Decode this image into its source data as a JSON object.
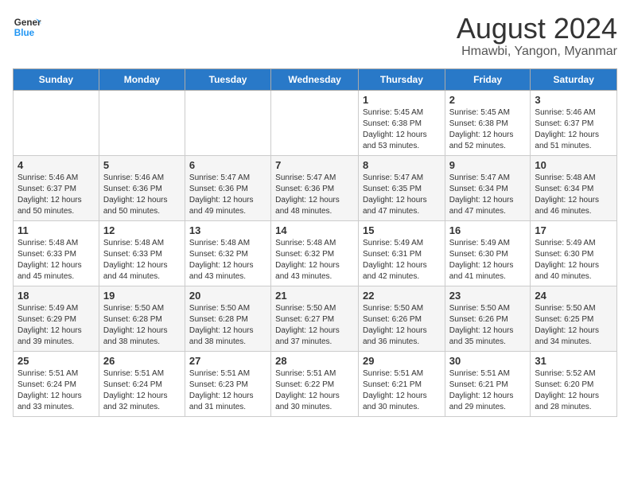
{
  "logo": {
    "line1": "General",
    "line2": "Blue"
  },
  "title": "August 2024",
  "subtitle": "Hmawbi, Yangon, Myanmar",
  "days_of_week": [
    "Sunday",
    "Monday",
    "Tuesday",
    "Wednesday",
    "Thursday",
    "Friday",
    "Saturday"
  ],
  "weeks": [
    [
      {
        "day": "",
        "info": ""
      },
      {
        "day": "",
        "info": ""
      },
      {
        "day": "",
        "info": ""
      },
      {
        "day": "",
        "info": ""
      },
      {
        "day": "1",
        "info": "Sunrise: 5:45 AM\nSunset: 6:38 PM\nDaylight: 12 hours\nand 53 minutes."
      },
      {
        "day": "2",
        "info": "Sunrise: 5:45 AM\nSunset: 6:38 PM\nDaylight: 12 hours\nand 52 minutes."
      },
      {
        "day": "3",
        "info": "Sunrise: 5:46 AM\nSunset: 6:37 PM\nDaylight: 12 hours\nand 51 minutes."
      }
    ],
    [
      {
        "day": "4",
        "info": "Sunrise: 5:46 AM\nSunset: 6:37 PM\nDaylight: 12 hours\nand 50 minutes."
      },
      {
        "day": "5",
        "info": "Sunrise: 5:46 AM\nSunset: 6:36 PM\nDaylight: 12 hours\nand 50 minutes."
      },
      {
        "day": "6",
        "info": "Sunrise: 5:47 AM\nSunset: 6:36 PM\nDaylight: 12 hours\nand 49 minutes."
      },
      {
        "day": "7",
        "info": "Sunrise: 5:47 AM\nSunset: 6:36 PM\nDaylight: 12 hours\nand 48 minutes."
      },
      {
        "day": "8",
        "info": "Sunrise: 5:47 AM\nSunset: 6:35 PM\nDaylight: 12 hours\nand 47 minutes."
      },
      {
        "day": "9",
        "info": "Sunrise: 5:47 AM\nSunset: 6:34 PM\nDaylight: 12 hours\nand 47 minutes."
      },
      {
        "day": "10",
        "info": "Sunrise: 5:48 AM\nSunset: 6:34 PM\nDaylight: 12 hours\nand 46 minutes."
      }
    ],
    [
      {
        "day": "11",
        "info": "Sunrise: 5:48 AM\nSunset: 6:33 PM\nDaylight: 12 hours\nand 45 minutes."
      },
      {
        "day": "12",
        "info": "Sunrise: 5:48 AM\nSunset: 6:33 PM\nDaylight: 12 hours\nand 44 minutes."
      },
      {
        "day": "13",
        "info": "Sunrise: 5:48 AM\nSunset: 6:32 PM\nDaylight: 12 hours\nand 43 minutes."
      },
      {
        "day": "14",
        "info": "Sunrise: 5:48 AM\nSunset: 6:32 PM\nDaylight: 12 hours\nand 43 minutes."
      },
      {
        "day": "15",
        "info": "Sunrise: 5:49 AM\nSunset: 6:31 PM\nDaylight: 12 hours\nand 42 minutes."
      },
      {
        "day": "16",
        "info": "Sunrise: 5:49 AM\nSunset: 6:30 PM\nDaylight: 12 hours\nand 41 minutes."
      },
      {
        "day": "17",
        "info": "Sunrise: 5:49 AM\nSunset: 6:30 PM\nDaylight: 12 hours\nand 40 minutes."
      }
    ],
    [
      {
        "day": "18",
        "info": "Sunrise: 5:49 AM\nSunset: 6:29 PM\nDaylight: 12 hours\nand 39 minutes."
      },
      {
        "day": "19",
        "info": "Sunrise: 5:50 AM\nSunset: 6:28 PM\nDaylight: 12 hours\nand 38 minutes."
      },
      {
        "day": "20",
        "info": "Sunrise: 5:50 AM\nSunset: 6:28 PM\nDaylight: 12 hours\nand 38 minutes."
      },
      {
        "day": "21",
        "info": "Sunrise: 5:50 AM\nSunset: 6:27 PM\nDaylight: 12 hours\nand 37 minutes."
      },
      {
        "day": "22",
        "info": "Sunrise: 5:50 AM\nSunset: 6:26 PM\nDaylight: 12 hours\nand 36 minutes."
      },
      {
        "day": "23",
        "info": "Sunrise: 5:50 AM\nSunset: 6:26 PM\nDaylight: 12 hours\nand 35 minutes."
      },
      {
        "day": "24",
        "info": "Sunrise: 5:50 AM\nSunset: 6:25 PM\nDaylight: 12 hours\nand 34 minutes."
      }
    ],
    [
      {
        "day": "25",
        "info": "Sunrise: 5:51 AM\nSunset: 6:24 PM\nDaylight: 12 hours\nand 33 minutes."
      },
      {
        "day": "26",
        "info": "Sunrise: 5:51 AM\nSunset: 6:24 PM\nDaylight: 12 hours\nand 32 minutes."
      },
      {
        "day": "27",
        "info": "Sunrise: 5:51 AM\nSunset: 6:23 PM\nDaylight: 12 hours\nand 31 minutes."
      },
      {
        "day": "28",
        "info": "Sunrise: 5:51 AM\nSunset: 6:22 PM\nDaylight: 12 hours\nand 30 minutes."
      },
      {
        "day": "29",
        "info": "Sunrise: 5:51 AM\nSunset: 6:21 PM\nDaylight: 12 hours\nand 30 minutes."
      },
      {
        "day": "30",
        "info": "Sunrise: 5:51 AM\nSunset: 6:21 PM\nDaylight: 12 hours\nand 29 minutes."
      },
      {
        "day": "31",
        "info": "Sunrise: 5:52 AM\nSunset: 6:20 PM\nDaylight: 12 hours\nand 28 minutes."
      }
    ]
  ]
}
